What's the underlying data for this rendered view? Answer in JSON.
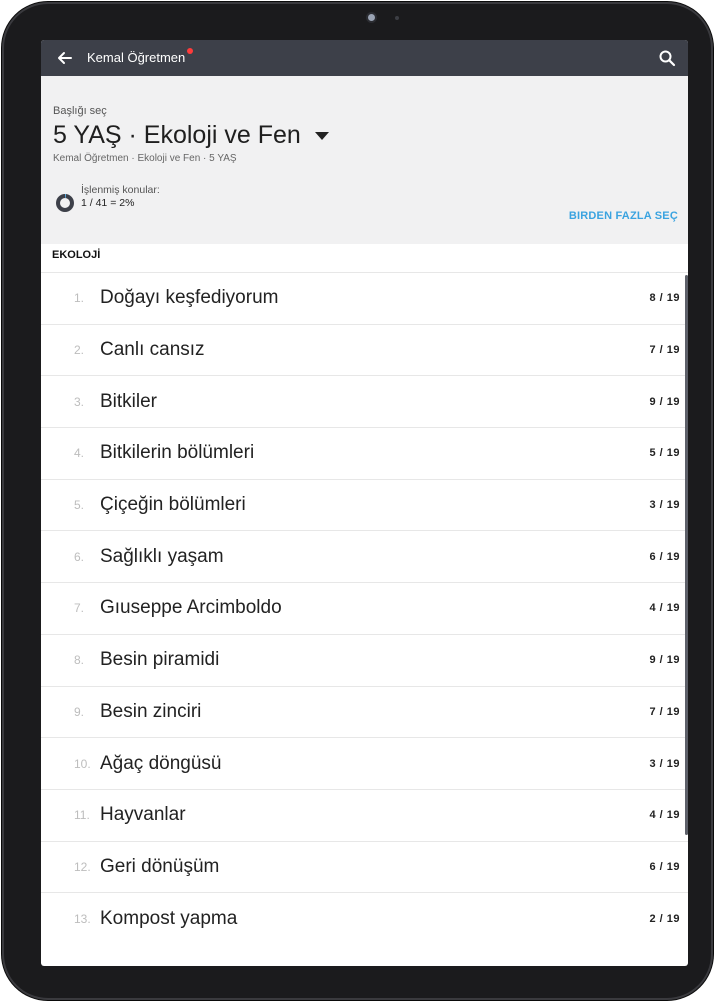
{
  "appbar": {
    "title": "Kemal Öğretmen",
    "back_icon": "arrow-left-icon",
    "search_icon": "search-icon",
    "notification_color": "#ff3b3b"
  },
  "header": {
    "select_hint": "Başlığı seç",
    "subject": "5 YAŞ · Ekoloji ve Fen",
    "breadcrumb": "Kemal Öğretmen · Ekoloji ve Fen · 5 YAŞ",
    "progress_label": "İşlenmiş konular:",
    "progress_value": "1 / 41 = 2%",
    "progress_fraction": 0.02,
    "multi_select_label": "BIRDEN FAZLA SEÇ",
    "accent_color": "#3aa3e0"
  },
  "section": {
    "title": "EKOLOJİ"
  },
  "topics": [
    {
      "num": "1.",
      "name": "Doğayı keşfediyorum",
      "count": "8 / 19"
    },
    {
      "num": "2.",
      "name": "Canlı cansız",
      "count": "7 / 19"
    },
    {
      "num": "3.",
      "name": "Bitkiler",
      "count": "9 / 19"
    },
    {
      "num": "4.",
      "name": "Bitkilerin bölümleri",
      "count": "5 / 19"
    },
    {
      "num": "5.",
      "name": "Çiçeğin bölümleri",
      "count": "3 / 19"
    },
    {
      "num": "6.",
      "name": "Sağlıklı yaşam",
      "count": "6 / 19"
    },
    {
      "num": "7.",
      "name": "Gıuseppe Arcimboldo",
      "count": "4 / 19"
    },
    {
      "num": "8.",
      "name": "Besin piramidi",
      "count": "9 / 19"
    },
    {
      "num": "9.",
      "name": "Besin zinciri",
      "count": "7 / 19"
    },
    {
      "num": "10.",
      "name": "Ağaç döngüsü",
      "count": "3 / 19"
    },
    {
      "num": "11.",
      "name": "Hayvanlar",
      "count": "4 / 19"
    },
    {
      "num": "12.",
      "name": "Geri dönüşüm",
      "count": "6 / 19"
    },
    {
      "num": "13.",
      "name": "Kompost yapma",
      "count": "2 / 19"
    }
  ]
}
